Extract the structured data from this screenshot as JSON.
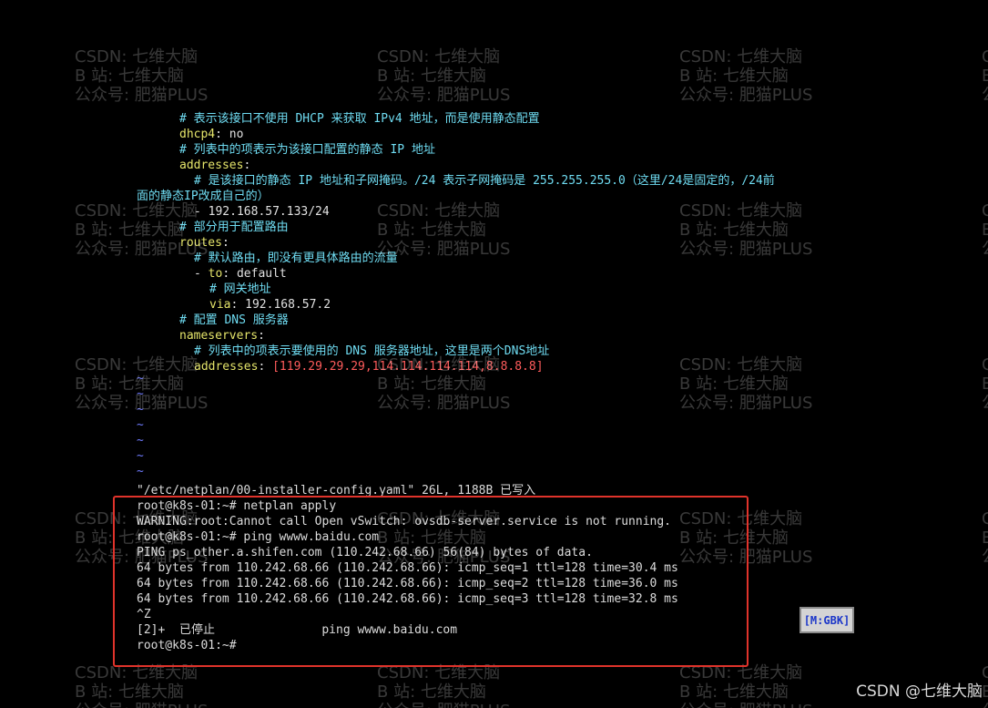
{
  "watermark": {
    "lines": [
      "CSDN: 七维大脑",
      "B  站: 七维大脑",
      "公众号: 肥猫PLUS"
    ]
  },
  "editor": {
    "comment_no_dhcp": "# 表示该接口不使用 DHCP 来获取 IPv4 地址，而是使用静态配置",
    "dhcp4_key": "dhcp4",
    "dhcp4_value": "no",
    "comment_addresses": "# 列表中的项表示为该接口配置的静态 IP 地址",
    "addresses_key": "addresses",
    "comment_ip_mask_1": "# 是该接口的静态 IP 地址和子网掩码。/24 表示子网掩码是 255.255.255.0（这里/24是固定的，/24前",
    "comment_ip_mask_2": "面的静态IP改成自己的）",
    "address_item": "- 192.168.57.133/24",
    "comment_routes": "# 部分用于配置路由",
    "routes_key": "routes",
    "comment_default_route": "# 默认路由，即没有更具体路由的流量",
    "route_to_key": "to",
    "route_to_value": "default",
    "comment_gateway": "# 网关地址",
    "via_key": "via",
    "via_value": "192.168.57.2",
    "comment_dns": "# 配置 DNS 服务器",
    "nameservers_key": "nameservers",
    "comment_dns_list": "# 列表中的项表示要使用的 DNS 服务器地址，这里是两个DNS地址",
    "dns_addresses_key": "addresses",
    "dns_addresses_value": "[119.29.29.29,114.114.114.114,8.8.8.8]",
    "tilde": "~",
    "status_line": "\"/etc/netplan/00-installer-config.yaml\" 26L, 1188B 已写入"
  },
  "shell": {
    "lines": [
      "root@k8s-01:~# netplan apply",
      "WARNING:root:Cannot call Open vSwitch: ovsdb-server.service is not running.",
      "root@k8s-01:~# ping wwww.baidu.com",
      "PING ps_other.a.shifen.com (110.242.68.66) 56(84) bytes of data.",
      "64 bytes from 110.242.68.66 (110.242.68.66): icmp_seq=1 ttl=128 time=30.4 ms",
      "64 bytes from 110.242.68.66 (110.242.68.66): icmp_seq=2 ttl=128 time=36.0 ms",
      "64 bytes from 110.242.68.66 (110.242.68.66): icmp_seq=3 ttl=128 time=32.8 ms",
      "^Z",
      "[2]+  已停止               ping wwww.baidu.com",
      "root@k8s-01:~#"
    ]
  },
  "encoding_badge": "[M:GBK]",
  "footer_mark": "CSDN @七维大脑"
}
